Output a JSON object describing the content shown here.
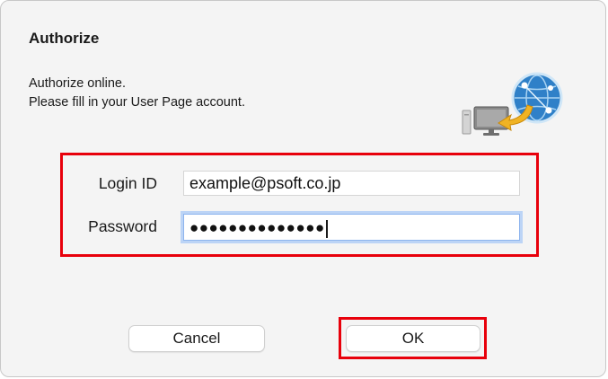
{
  "dialog": {
    "title": "Authorize",
    "description_line1": "Authorize online.",
    "description_line2": "Please fill in your User Page account."
  },
  "form": {
    "login_label": "Login ID",
    "login_value": "example@psoft.co.jp",
    "password_label": "Password",
    "password_masked": "●●●●●●●●●●●●●●"
  },
  "buttons": {
    "cancel_label": "Cancel",
    "ok_label": "OK"
  },
  "colors": {
    "highlight": "#e8000b",
    "focus_ring": "#bcd4f6",
    "globe": "#2f80c8",
    "arrow": "#f0b323"
  },
  "icons": {
    "illustration": "computer-globe-sync-icon"
  }
}
